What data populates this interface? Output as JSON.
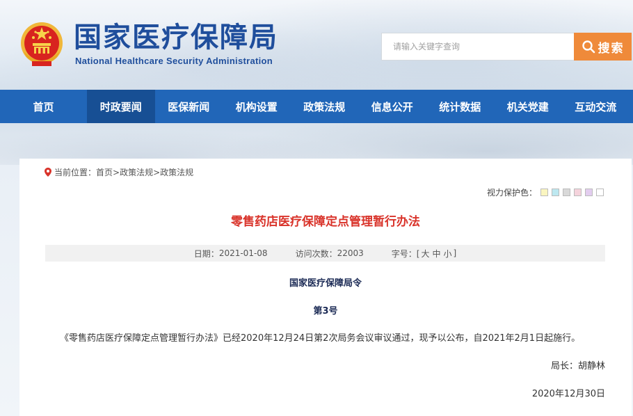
{
  "header": {
    "title_cn": "国家医疗保障局",
    "title_en": "National Healthcare Security Administration",
    "search_placeholder": "请输入关键字查询",
    "search_button": "搜索"
  },
  "nav": {
    "items": [
      {
        "label": "首页"
      },
      {
        "label": "时政要闻"
      },
      {
        "label": "医保新闻"
      },
      {
        "label": "机构设置"
      },
      {
        "label": "政策法规"
      },
      {
        "label": "信息公开"
      },
      {
        "label": "统计数据"
      },
      {
        "label": "机关党建"
      },
      {
        "label": "互动交流"
      }
    ],
    "active_index": 1
  },
  "breadcrumb": {
    "prefix": "当前位置：",
    "path": "首页>政策法规>政策法规"
  },
  "eye_care": {
    "label": "视力保护色：",
    "colors": [
      "#faf5c0",
      "#bde8f0",
      "#d9d9d9",
      "#f5d3dc",
      "#e3cdef",
      "#ffffff"
    ]
  },
  "article": {
    "title": "零售药店医疗保障定点管理暂行办法",
    "meta": {
      "date_label": "日期：",
      "date": "2021-01-08",
      "visits_label": "访问次数：",
      "visits": "22003",
      "font_label": "字号：[",
      "font_large": "大",
      "font_medium": "中",
      "font_small": "小",
      "font_end": "]"
    },
    "decree_org": "国家医疗保障局令",
    "decree_no": "第3号",
    "body": "《零售药店医疗保障定点管理暂行办法》已经2020年12月24日第2次局务会议审议通过，现予以公布，自2021年2月1日起施行。",
    "signer": "局长：胡静林",
    "sign_date": "2020年12月30日"
  },
  "colors": {
    "nav_bg": "#2166b8",
    "nav_active": "#174f94",
    "search_button": "#ef8a3a",
    "title_red": "#d9332a",
    "brand_blue": "#1f4e9c"
  }
}
